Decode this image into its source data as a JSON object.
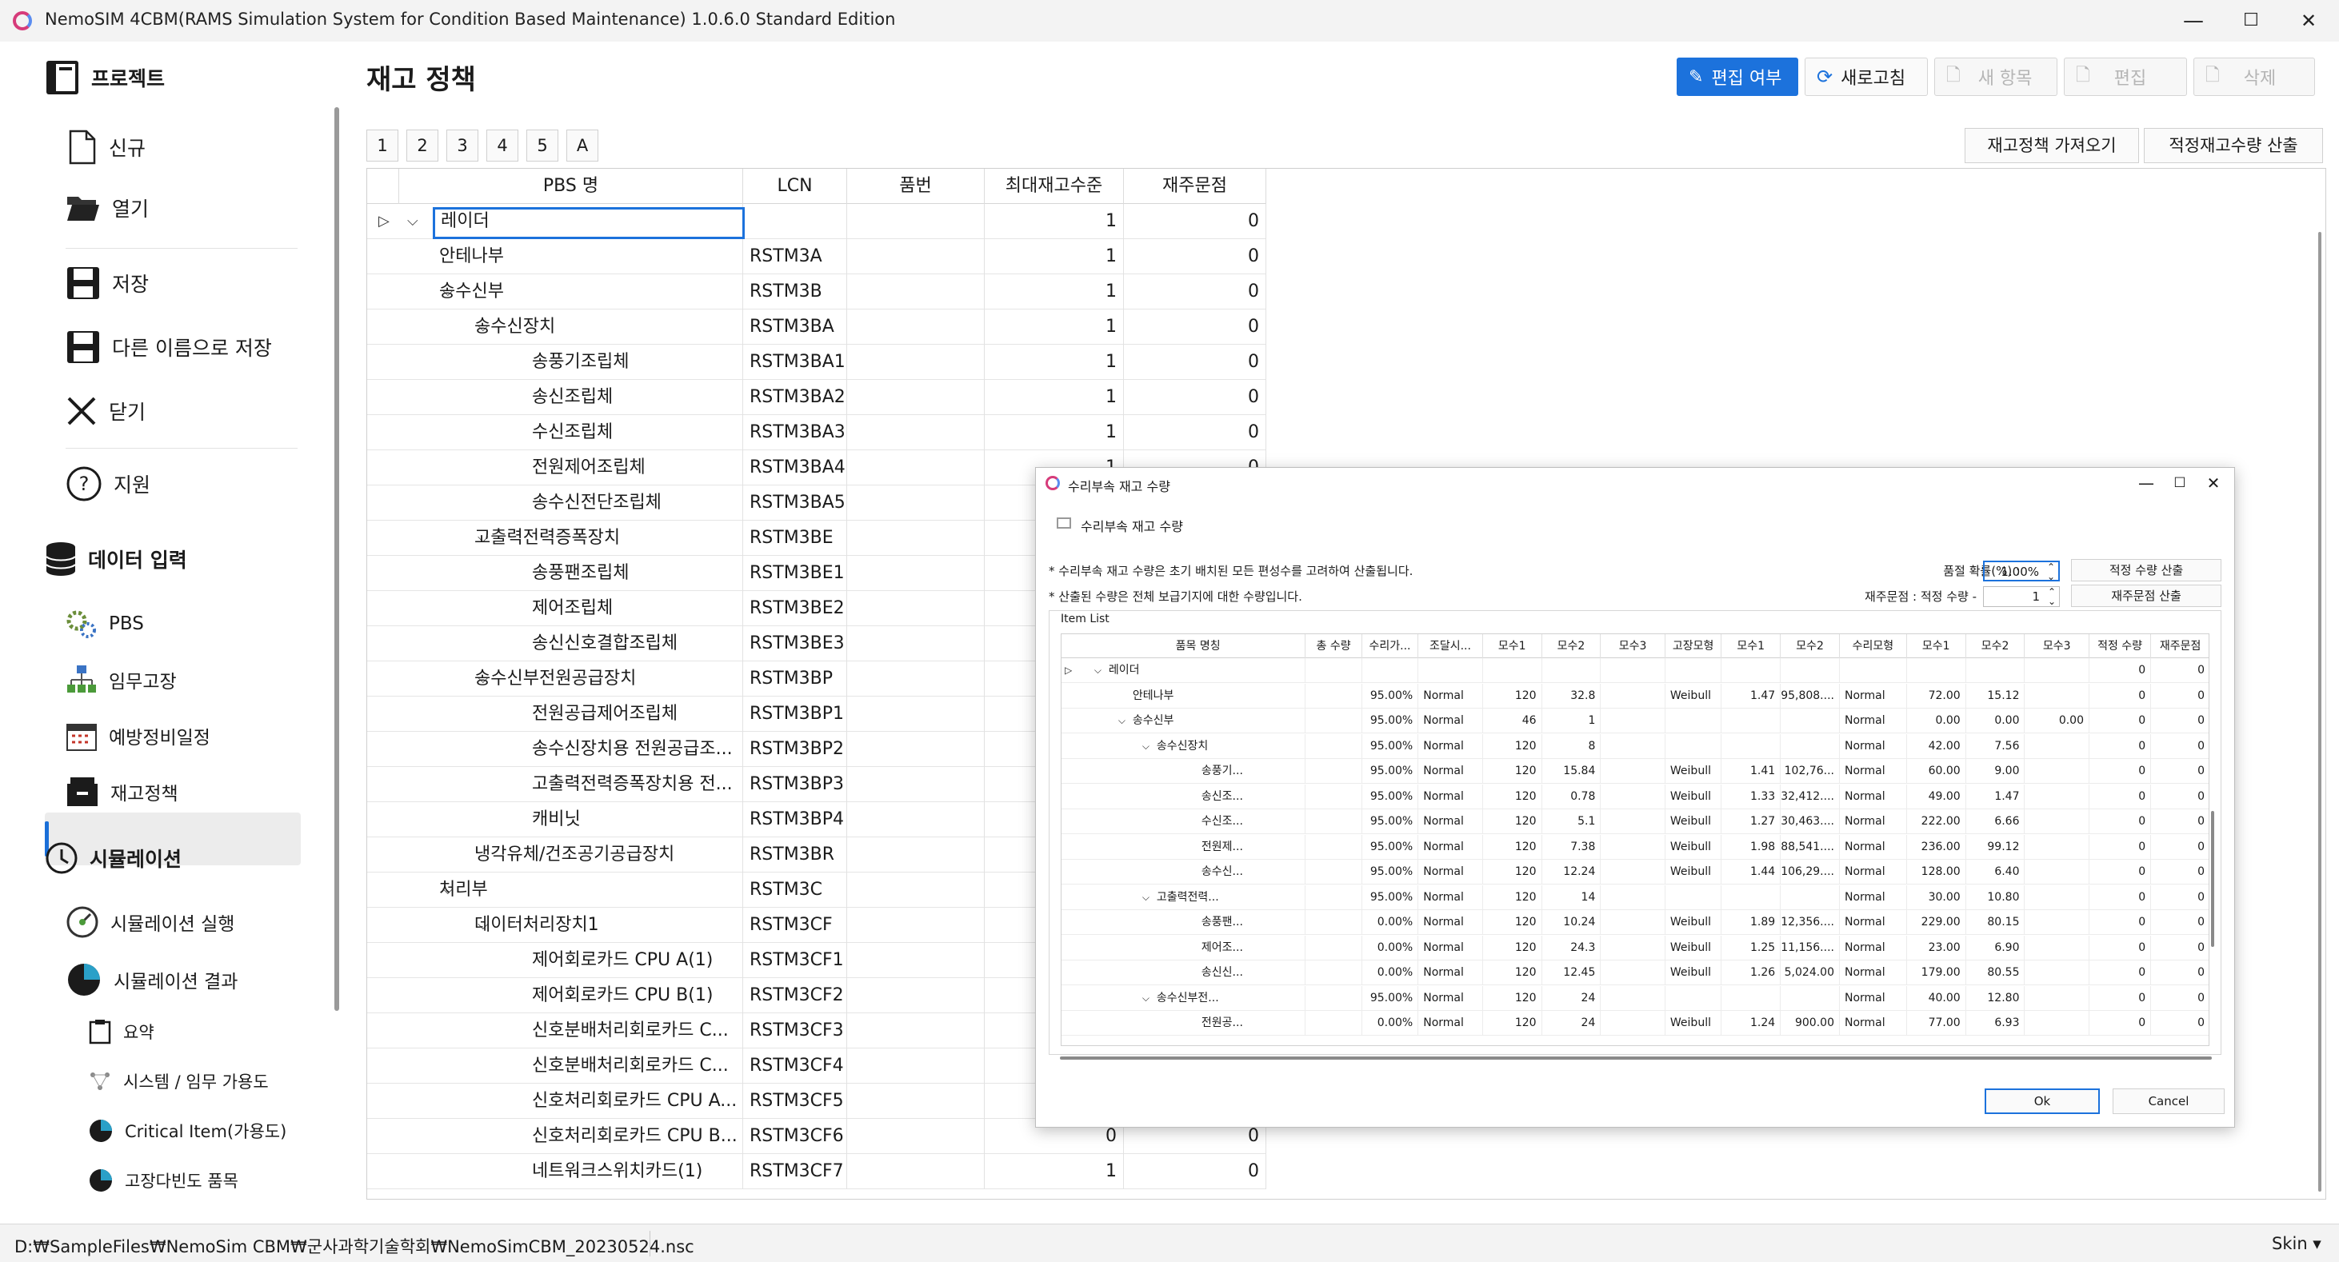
{
  "window": {
    "title": "NemoSIM 4CBM(RAMS Simulation System for Condition Based Maintenance) 1.0.6.0 Standard Edition",
    "min": "—",
    "max": "☐",
    "close": "✕"
  },
  "sidebar": {
    "project": "프로젝트",
    "new": "신규",
    "open": "열기",
    "save": "저장",
    "saveas": "다른 이름으로 저장",
    "close": "닫기",
    "help": "지원",
    "data_input": "데이터 입력",
    "pbs": "PBS",
    "mission": "임무고장",
    "prevent": "예방정비일정",
    "inventory": "재고정책",
    "simulation": "시뮬레이션",
    "sim_run": "시뮬레이션 실행",
    "sim_result": "시뮬레이션 결과",
    "summary": "요약",
    "sys_avail": "시스템 / 임무 가용도",
    "critical": "Critical Item(가용도)",
    "failure_freq": "고장다빈도 품목"
  },
  "page": {
    "title": "재고 정책"
  },
  "toolbar": {
    "edit": "편집 여부",
    "refresh": "새로고침",
    "new_item": "새 항목",
    "edit2": "편집",
    "delete": "삭제"
  },
  "tabs": [
    "1",
    "2",
    "3",
    "4",
    "5",
    "A"
  ],
  "actions": {
    "import": "재고정책 가져오기",
    "calc": "적정재고수량 산출"
  },
  "grid": {
    "headers": [
      "PBS 명",
      "LCN",
      "품번",
      "최대재고수준",
      "재주문점"
    ],
    "rows": [
      {
        "name": "레이더",
        "lcn": "",
        "pn": "",
        "max": "1",
        "re": "0",
        "lvl": 0,
        "exp": "v"
      },
      {
        "name": "안테나부",
        "lcn": "RSTM3A",
        "pn": "",
        "max": "1",
        "re": "0",
        "lvl": 1,
        "exp": ""
      },
      {
        "name": "송수신부",
        "lcn": "RSTM3B",
        "pn": "",
        "max": "1",
        "re": "0",
        "lvl": 1,
        "exp": "v"
      },
      {
        "name": "송수신장치",
        "lcn": "RSTM3BA",
        "pn": "",
        "max": "1",
        "re": "0",
        "lvl": 2,
        "exp": "v"
      },
      {
        "name": "송풍기조립체",
        "lcn": "RSTM3BA1",
        "pn": "",
        "max": "1",
        "re": "0",
        "lvl": 3,
        "exp": ""
      },
      {
        "name": "송신조립체",
        "lcn": "RSTM3BA2",
        "pn": "",
        "max": "1",
        "re": "0",
        "lvl": 3,
        "exp": ""
      },
      {
        "name": "수신조립체",
        "lcn": "RSTM3BA3",
        "pn": "",
        "max": "1",
        "re": "0",
        "lvl": 3,
        "exp": ""
      },
      {
        "name": "전원제어조립체",
        "lcn": "RSTM3BA4",
        "pn": "",
        "max": "1",
        "re": "0",
        "lvl": 3,
        "exp": ""
      },
      {
        "name": "송수신전단조립체",
        "lcn": "RSTM3BA5",
        "pn": "",
        "max": "",
        "re": "",
        "lvl": 3,
        "exp": ""
      },
      {
        "name": "고출력전력증폭장치",
        "lcn": "RSTM3BE",
        "pn": "",
        "max": "",
        "re": "",
        "lvl": 2,
        "exp": "v"
      },
      {
        "name": "송풍팬조립체",
        "lcn": "RSTM3BE1",
        "pn": "",
        "max": "",
        "re": "",
        "lvl": 3,
        "exp": ""
      },
      {
        "name": "제어조립체",
        "lcn": "RSTM3BE2",
        "pn": "",
        "max": "",
        "re": "",
        "lvl": 3,
        "exp": ""
      },
      {
        "name": "송신신호결합조립체",
        "lcn": "RSTM3BE3",
        "pn": "",
        "max": "",
        "re": "",
        "lvl": 3,
        "exp": ""
      },
      {
        "name": "송수신부전원공급장치",
        "lcn": "RSTM3BP",
        "pn": "",
        "max": "",
        "re": "",
        "lvl": 2,
        "exp": "v"
      },
      {
        "name": "전원공급제어조립체",
        "lcn": "RSTM3BP1",
        "pn": "",
        "max": "",
        "re": "",
        "lvl": 3,
        "exp": ""
      },
      {
        "name": "송수신장치용 전원공급조...",
        "lcn": "RSTM3BP2",
        "pn": "",
        "max": "",
        "re": "",
        "lvl": 3,
        "exp": ""
      },
      {
        "name": "고출력전력증폭장치용 전...",
        "lcn": "RSTM3BP3",
        "pn": "",
        "max": "",
        "re": "",
        "lvl": 3,
        "exp": ""
      },
      {
        "name": "캐비닛",
        "lcn": "RSTM3BP4",
        "pn": "",
        "max": "",
        "re": "",
        "lvl": 3,
        "exp": ""
      },
      {
        "name": "냉각유체/건조공기공급장치",
        "lcn": "RSTM3BR",
        "pn": "",
        "max": "",
        "re": "",
        "lvl": 2,
        "exp": ""
      },
      {
        "name": "처리부",
        "lcn": "RSTM3C",
        "pn": "",
        "max": "",
        "re": "",
        "lvl": 1,
        "exp": "v"
      },
      {
        "name": "데이터처리장치1",
        "lcn": "RSTM3CF",
        "pn": "",
        "max": "",
        "re": "",
        "lvl": 2,
        "exp": "v"
      },
      {
        "name": "제어회로카드 CPU A(1)",
        "lcn": "RSTM3CF1",
        "pn": "",
        "max": "",
        "re": "",
        "lvl": 3,
        "exp": ""
      },
      {
        "name": "제어회로카드 CPU B(1)",
        "lcn": "RSTM3CF2",
        "pn": "",
        "max": "",
        "re": "",
        "lvl": 3,
        "exp": ""
      },
      {
        "name": "신호분배처리회로카드 C...",
        "lcn": "RSTM3CF3",
        "pn": "",
        "max": "",
        "re": "",
        "lvl": 3,
        "exp": ""
      },
      {
        "name": "신호분배처리회로카드 C...",
        "lcn": "RSTM3CF4",
        "pn": "",
        "max": "",
        "re": "",
        "lvl": 3,
        "exp": ""
      },
      {
        "name": "신호처리회로카드 CPU A...",
        "lcn": "RSTM3CF5",
        "pn": "",
        "max": "",
        "re": "",
        "lvl": 3,
        "exp": ""
      },
      {
        "name": "신호처리회로카드 CPU B...",
        "lcn": "RSTM3CF6",
        "pn": "",
        "max": "0",
        "re": "0",
        "lvl": 3,
        "exp": ""
      },
      {
        "name": "네트워크스위치카드(1)",
        "lcn": "RSTM3CF7",
        "pn": "",
        "max": "1",
        "re": "0",
        "lvl": 3,
        "exp": ""
      }
    ]
  },
  "dialog": {
    "title": "수리부속 재고 수량",
    "subtitle": "수리부속 재고 수량",
    "note1": "* 수리부속 재고 수량은 초기 배치된 모든 편성수를 고려하여 산출됩니다.",
    "note2": "* 산출된 수량은 전체 보급기지에 대한 수량입니다.",
    "prob_label": "품절 확률(%) :",
    "prob_value": "1.00%",
    "calc_btn": "적정 수량 산출",
    "reorder_label": "재주문점 : 적정 수량 -",
    "reorder_value": "1",
    "reorder_btn": "재주문점 산출",
    "item_list": "Item List",
    "headers": [
      "품목 명칭",
      "총 수량",
      "수리가...",
      "조달시...",
      "모수1",
      "모수2",
      "모수3",
      "고장모형",
      "모수1",
      "모수2",
      "수리모형",
      "모수1",
      "모수2",
      "모수3",
      "적정 수량",
      "재주문점"
    ],
    "rows": [
      {
        "c": [
          "레이더",
          "",
          "",
          "",
          "",
          "",
          "",
          "",
          "",
          "",
          "",
          "",
          "",
          "",
          "0",
          "0"
        ],
        "lvl": 0,
        "exp": "v"
      },
      {
        "c": [
          "안테나부",
          "",
          "95.00%",
          "Normal",
          "120",
          "32.8",
          "",
          "Weibull",
          "1.47",
          "95,808....",
          "Normal",
          "72.00",
          "15.12",
          "",
          "0",
          "0"
        ],
        "lvl": 1,
        "exp": ""
      },
      {
        "c": [
          "송수신부",
          "",
          "95.00%",
          "Normal",
          "46",
          "1",
          "",
          "",
          "",
          "",
          "Normal",
          "0.00",
          "0.00",
          "0.00",
          "0",
          "0"
        ],
        "lvl": 1,
        "exp": "v"
      },
      {
        "c": [
          "송수신장치",
          "",
          "95.00%",
          "Normal",
          "120",
          "8",
          "",
          "",
          "",
          "",
          "Normal",
          "42.00",
          "7.56",
          "",
          "0",
          "0"
        ],
        "lvl": 2,
        "exp": "v"
      },
      {
        "c": [
          "송풍기...",
          "",
          "95.00%",
          "Normal",
          "120",
          "15.84",
          "",
          "Weibull",
          "1.41",
          "102,76...",
          "Normal",
          "60.00",
          "9.00",
          "",
          "0",
          "0"
        ],
        "lvl": 3,
        "exp": ""
      },
      {
        "c": [
          "송신조...",
          "",
          "95.00%",
          "Normal",
          "120",
          "0.78",
          "",
          "Weibull",
          "1.33",
          "32,412....",
          "Normal",
          "49.00",
          "1.47",
          "",
          "0",
          "0"
        ],
        "lvl": 3,
        "exp": ""
      },
      {
        "c": [
          "수신조...",
          "",
          "95.00%",
          "Normal",
          "120",
          "5.1",
          "",
          "Weibull",
          "1.27",
          "30,463....",
          "Normal",
          "222.00",
          "6.66",
          "",
          "0",
          "0"
        ],
        "lvl": 3,
        "exp": ""
      },
      {
        "c": [
          "전원제...",
          "",
          "95.00%",
          "Normal",
          "120",
          "7.38",
          "",
          "Weibull",
          "1.98",
          "88,541....",
          "Normal",
          "236.00",
          "99.12",
          "",
          "0",
          "0"
        ],
        "lvl": 3,
        "exp": ""
      },
      {
        "c": [
          "송수신...",
          "",
          "95.00%",
          "Normal",
          "120",
          "12.24",
          "",
          "Weibull",
          "1.44",
          "106,29....",
          "Normal",
          "128.00",
          "6.40",
          "",
          "0",
          "0"
        ],
        "lvl": 3,
        "exp": ""
      },
      {
        "c": [
          "고출력전력...",
          "",
          "95.00%",
          "Normal",
          "120",
          "14",
          "",
          "",
          "",
          "",
          "Normal",
          "30.00",
          "10.80",
          "",
          "0",
          "0"
        ],
        "lvl": 2,
        "exp": "v"
      },
      {
        "c": [
          "송풍팬...",
          "",
          "0.00%",
          "Normal",
          "120",
          "10.24",
          "",
          "Weibull",
          "1.89",
          "12,356....",
          "Normal",
          "229.00",
          "80.15",
          "",
          "0",
          "0"
        ],
        "lvl": 3,
        "exp": ""
      },
      {
        "c": [
          "제어조...",
          "",
          "0.00%",
          "Normal",
          "120",
          "24.3",
          "",
          "Weibull",
          "1.25",
          "11,156....",
          "Normal",
          "23.00",
          "6.90",
          "",
          "0",
          "0"
        ],
        "lvl": 3,
        "exp": ""
      },
      {
        "c": [
          "송신신...",
          "",
          "0.00%",
          "Normal",
          "120",
          "12.45",
          "",
          "Weibull",
          "1.26",
          "5,024.00",
          "Normal",
          "179.00",
          "80.55",
          "",
          "0",
          "0"
        ],
        "lvl": 3,
        "exp": ""
      },
      {
        "c": [
          "송수신부전...",
          "",
          "95.00%",
          "Normal",
          "120",
          "24",
          "",
          "",
          "",
          "",
          "Normal",
          "40.00",
          "12.80",
          "",
          "0",
          "0"
        ],
        "lvl": 2,
        "exp": "v"
      },
      {
        "c": [
          "전원공...",
          "",
          "0.00%",
          "Normal",
          "120",
          "24",
          "",
          "Weibull",
          "1.24",
          "900.00",
          "Normal",
          "77.00",
          "6.93",
          "",
          "0",
          "0"
        ],
        "lvl": 3,
        "exp": ""
      }
    ],
    "ok": "Ok",
    "cancel": "Cancel"
  },
  "status": {
    "path": "D:₩SampleFiles₩NemoSim CBM₩군사과학기술학회₩NemoSimCBM_20230524.nsc",
    "skin": "Skin ▾"
  }
}
